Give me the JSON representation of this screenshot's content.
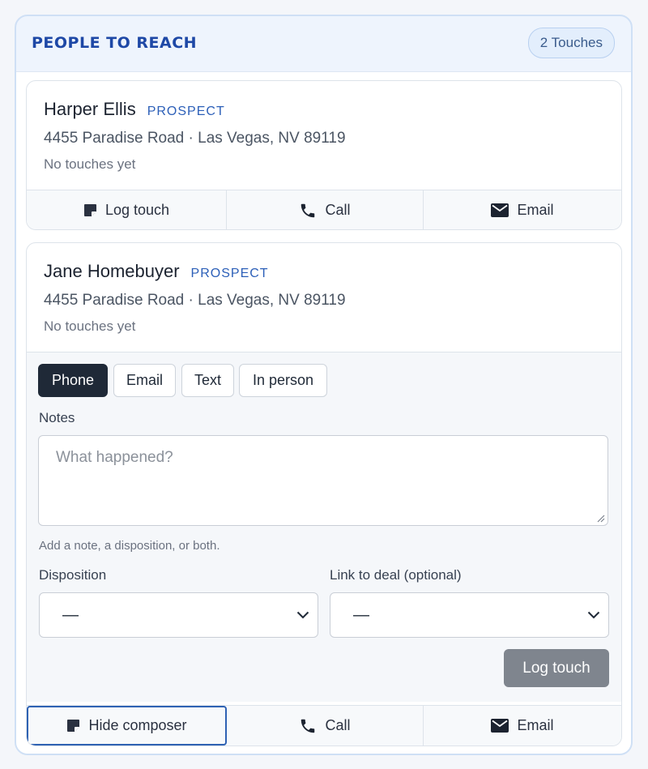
{
  "header": {
    "title": "PEOPLE TO REACH",
    "badge": "2 Touches"
  },
  "contacts": [
    {
      "name": "Harper Ellis",
      "tag": "PROSPECT",
      "address": "4455 Paradise Road · Las Vegas, NV 89119",
      "touch_status": "No touches yet",
      "actions": {
        "log_touch": "Log touch",
        "call": "Call",
        "email": "Email"
      }
    },
    {
      "name": "Jane Homebuyer",
      "tag": "PROSPECT",
      "address": "4455 Paradise Road · Las Vegas, NV 89119",
      "touch_status": "No touches yet",
      "composer": {
        "channels": [
          "Phone",
          "Email",
          "Text",
          "In person"
        ],
        "selected_channel": "Phone",
        "notes_label": "Notes",
        "notes_placeholder": "What happened?",
        "helper": "Add a note, a disposition, or both.",
        "disposition_label": "Disposition",
        "disposition_value": "—",
        "deal_label": "Link to deal (optional)",
        "deal_value": "—",
        "submit": "Log touch"
      },
      "actions": {
        "hide_composer": "Hide composer",
        "call": "Call",
        "email": "Email"
      }
    }
  ]
}
